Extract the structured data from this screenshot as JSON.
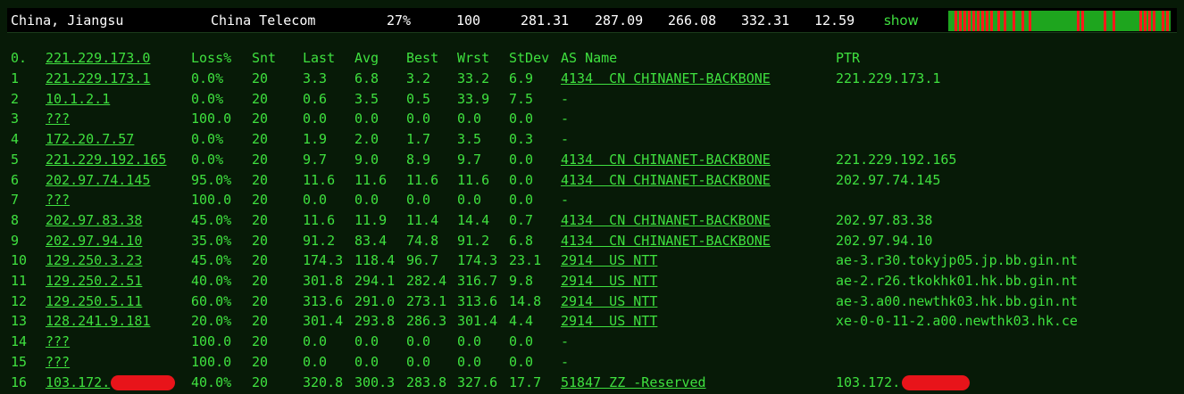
{
  "summary": {
    "location": "China, Jiangsu",
    "isp": "China Telecom",
    "loss": "27%",
    "sent": "100",
    "last": "281.31",
    "avg": "287.09",
    "best": "266.08",
    "worst": "332.31",
    "stdev": "12.59",
    "show_label": "show"
  },
  "colors": {
    "background": "#071a07",
    "text": "#3fe03f",
    "bar_ok": "#1ea51e",
    "bar_loss": "#ff1a1a",
    "redaction": "#e8141a"
  },
  "table": {
    "headers": {
      "hop": "0.",
      "host": "221.229.173.0",
      "loss": "Loss%",
      "snt": "Snt",
      "last": "Last",
      "avg": "Avg",
      "best": "Best",
      "wrst": "Wrst",
      "stdev": "StDev",
      "asname": "AS Name",
      "ptr": "PTR"
    },
    "rows": [
      {
        "hop": "1",
        "host": "221.229.173.1",
        "loss": "0.0%",
        "snt": "20",
        "last": "3.3",
        "avg": "6.8",
        "best": "3.2",
        "wrst": "33.2",
        "stdev": "6.9",
        "asname": "4134  CN CHINANET-BACKBONE",
        "ptr": "221.229.173.1"
      },
      {
        "hop": "2",
        "host": "10.1.2.1",
        "loss": "0.0%",
        "snt": "20",
        "last": "0.6",
        "avg": "3.5",
        "best": "0.5",
        "wrst": "33.9",
        "stdev": "7.5",
        "asname": "-",
        "ptr": ""
      },
      {
        "hop": "3",
        "host": "???",
        "loss": "100.0",
        "snt": "20",
        "last": "0.0",
        "avg": "0.0",
        "best": "0.0",
        "wrst": "0.0",
        "stdev": "0.0",
        "asname": "-",
        "ptr": ""
      },
      {
        "hop": "4",
        "host": "172.20.7.57",
        "loss": "0.0%",
        "snt": "20",
        "last": "1.9",
        "avg": "2.0",
        "best": "1.7",
        "wrst": "3.5",
        "stdev": "0.3",
        "asname": "-",
        "ptr": ""
      },
      {
        "hop": "5",
        "host": "221.229.192.165",
        "loss": "0.0%",
        "snt": "20",
        "last": "9.7",
        "avg": "9.0",
        "best": "8.9",
        "wrst": "9.7",
        "stdev": "0.0",
        "asname": "4134  CN CHINANET-BACKBONE",
        "ptr": "221.229.192.165"
      },
      {
        "hop": "6",
        "host": "202.97.74.145",
        "loss": "95.0%",
        "snt": "20",
        "last": "11.6",
        "avg": "11.6",
        "best": "11.6",
        "wrst": "11.6",
        "stdev": "0.0",
        "asname": "4134  CN CHINANET-BACKBONE",
        "ptr": "202.97.74.145"
      },
      {
        "hop": "7",
        "host": "???",
        "loss": "100.0",
        "snt": "20",
        "last": "0.0",
        "avg": "0.0",
        "best": "0.0",
        "wrst": "0.0",
        "stdev": "0.0",
        "asname": "-",
        "ptr": ""
      },
      {
        "hop": "8",
        "host": "202.97.83.38",
        "loss": "45.0%",
        "snt": "20",
        "last": "11.6",
        "avg": "11.9",
        "best": "11.4",
        "wrst": "14.4",
        "stdev": "0.7",
        "asname": "4134  CN CHINANET-BACKBONE",
        "ptr": "202.97.83.38"
      },
      {
        "hop": "9",
        "host": "202.97.94.10",
        "loss": "35.0%",
        "snt": "20",
        "last": "91.2",
        "avg": "83.4",
        "best": "74.8",
        "wrst": "91.2",
        "stdev": "6.8",
        "asname": "4134  CN CHINANET-BACKBONE",
        "ptr": "202.97.94.10"
      },
      {
        "hop": "10",
        "host": "129.250.3.23",
        "loss": "45.0%",
        "snt": "20",
        "last": "174.3",
        "avg": "118.4",
        "best": "96.7",
        "wrst": "174.3",
        "stdev": "23.1",
        "asname": "2914  US NTT",
        "ptr": "ae-3.r30.tokyjp05.jp.bb.gin.nt"
      },
      {
        "hop": "11",
        "host": "129.250.2.51",
        "loss": "40.0%",
        "snt": "20",
        "last": "301.8",
        "avg": "294.1",
        "best": "282.4",
        "wrst": "316.7",
        "stdev": "9.8",
        "asname": "2914  US NTT",
        "ptr": "ae-2.r26.tkokhk01.hk.bb.gin.nt"
      },
      {
        "hop": "12",
        "host": "129.250.5.11",
        "loss": "60.0%",
        "snt": "20",
        "last": "313.6",
        "avg": "291.0",
        "best": "273.1",
        "wrst": "313.6",
        "stdev": "14.8",
        "asname": "2914  US NTT",
        "ptr": "ae-3.a00.newthk03.hk.bb.gin.nt"
      },
      {
        "hop": "13",
        "host": "128.241.9.181",
        "loss": "20.0%",
        "snt": "20",
        "last": "301.4",
        "avg": "293.8",
        "best": "286.3",
        "wrst": "301.4",
        "stdev": "4.4",
        "asname": "2914  US NTT",
        "ptr": "xe-0-0-11-2.a00.newthk03.hk.ce"
      },
      {
        "hop": "14",
        "host": "???",
        "loss": "100.0",
        "snt": "20",
        "last": "0.0",
        "avg": "0.0",
        "best": "0.0",
        "wrst": "0.0",
        "stdev": "0.0",
        "asname": "-",
        "ptr": ""
      },
      {
        "hop": "15",
        "host": "???",
        "loss": "100.0",
        "snt": "20",
        "last": "0.0",
        "avg": "0.0",
        "best": "0.0",
        "wrst": "0.0",
        "stdev": "0.0",
        "asname": "-",
        "ptr": ""
      },
      {
        "hop": "16",
        "host": "103.172.",
        "loss": "40.0%",
        "snt": "20",
        "last": "320.8",
        "avg": "300.3",
        "best": "283.8",
        "wrst": "327.6",
        "stdev": "17.7",
        "asname": "51847 ZZ -Reserved",
        "ptr": "103.172."
      }
    ]
  },
  "lossbar": {
    "loss_samples": [
      0.03,
      0.05,
      0.07,
      0.09,
      0.11,
      0.13,
      0.15,
      0.17,
      0.19,
      0.22,
      0.25,
      0.29,
      0.33,
      0.36,
      0.58,
      0.6,
      0.7,
      0.74,
      0.86,
      0.88,
      0.9,
      0.92,
      0.96,
      0.98
    ]
  }
}
